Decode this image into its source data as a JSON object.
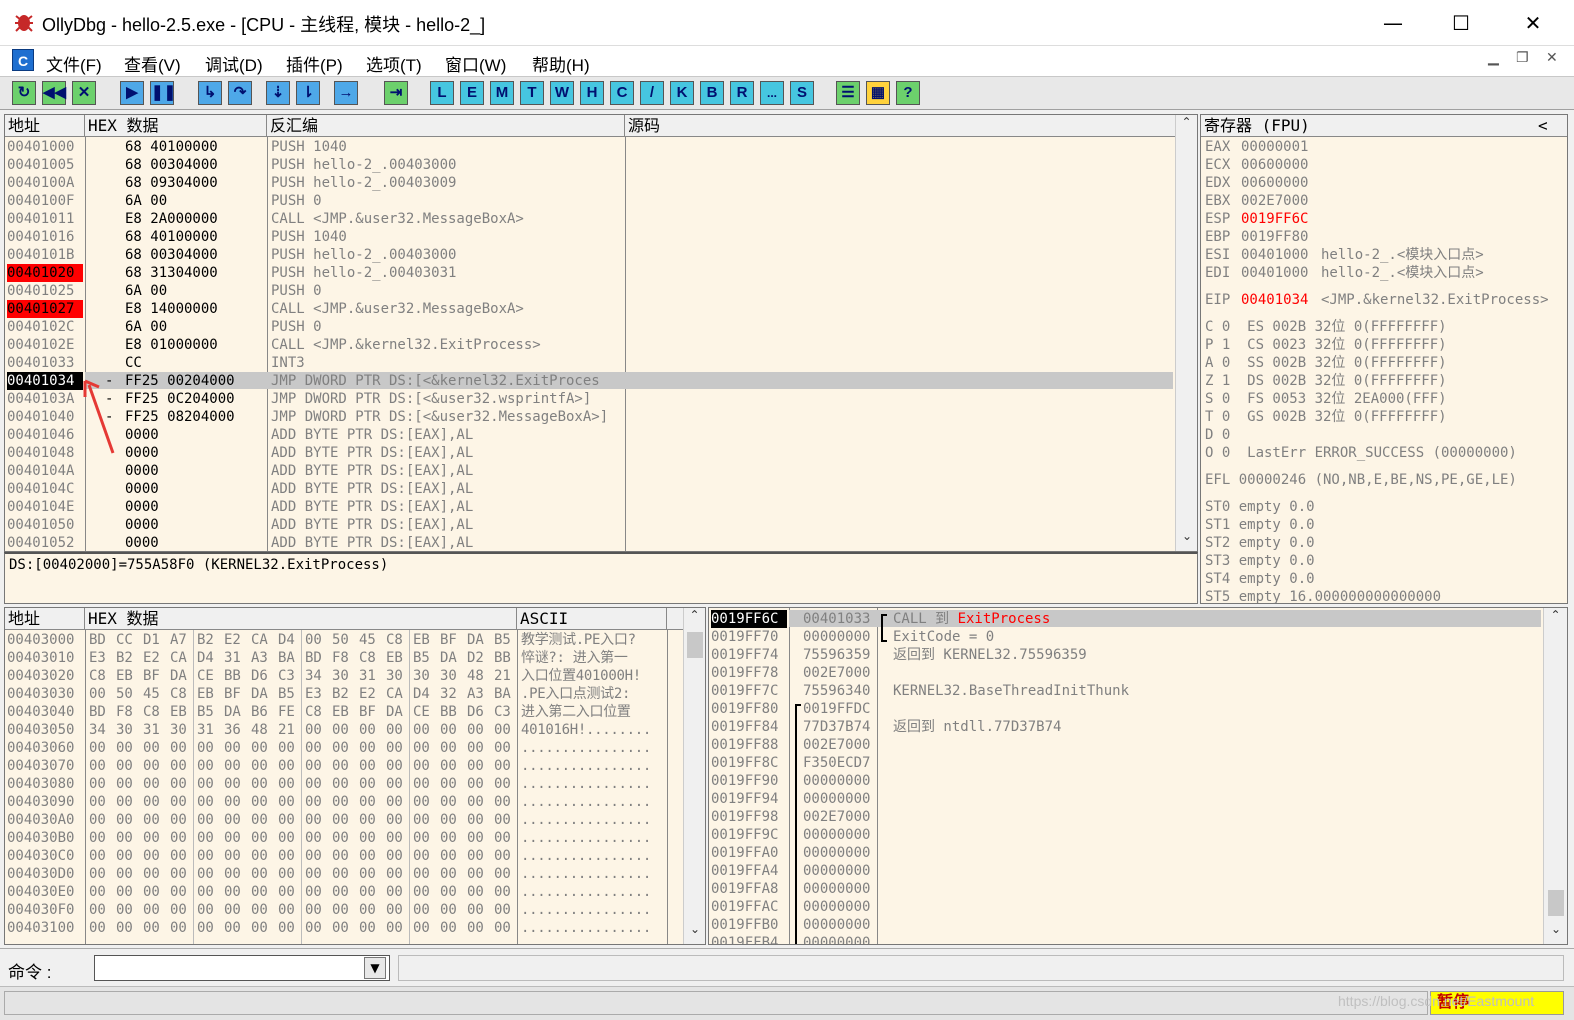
{
  "window": {
    "title": "OllyDbg - hello-2.5.exe - [CPU - 主线程, 模块 - hello-2_]",
    "min": "—",
    "max": "☐",
    "close": "✕"
  },
  "menu": [
    "文件(F)",
    "查看(V)",
    "调试(D)",
    "插件(P)",
    "选项(T)",
    "窗口(W)",
    "帮助(H)"
  ],
  "toolbar": {
    "letters": [
      "L",
      "E",
      "M",
      "T",
      "W",
      "H",
      "C",
      "/",
      "K",
      "B",
      "R",
      "...",
      "S"
    ]
  },
  "disasm": {
    "headers": [
      "地址",
      "HEX 数据",
      "反汇编",
      "源码"
    ],
    "rows": [
      {
        "a": "00401000",
        "m": "",
        "h": "68 40100000",
        "d": "PUSH 1040"
      },
      {
        "a": "00401005",
        "m": "",
        "h": "68 00304000",
        "d": "PUSH hello-2_.00403000"
      },
      {
        "a": "0040100A",
        "m": "",
        "h": "68 09304000",
        "d": "PUSH hello-2_.00403009"
      },
      {
        "a": "0040100F",
        "m": "",
        "h": "6A 00",
        "d": "PUSH 0"
      },
      {
        "a": "00401011",
        "m": "",
        "h": "E8 2A000000",
        "d": "CALL <JMP.&user32.MessageBoxA>"
      },
      {
        "a": "00401016",
        "m": "",
        "h": "68 40100000",
        "d": "PUSH 1040"
      },
      {
        "a": "0040101B",
        "m": "",
        "h": "68 00304000",
        "d": "PUSH hello-2_.00403000"
      },
      {
        "a": "00401020",
        "m": "",
        "h": "68 31304000",
        "d": "PUSH hello-2_.00403031"
      },
      {
        "a": "00401025",
        "m": "",
        "h": "6A 00",
        "d": "PUSH 0"
      },
      {
        "a": "00401027",
        "m": "",
        "h": "E8 14000000",
        "d": "CALL <JMP.&user32.MessageBoxA>"
      },
      {
        "a": "0040102C",
        "m": "",
        "h": "6A 00",
        "d": "PUSH 0"
      },
      {
        "a": "0040102E",
        "m": "",
        "h": "E8 01000000",
        "d": "CALL <JMP.&kernel32.ExitProcess>"
      },
      {
        "a": "00401033",
        "m": "",
        "h": "CC",
        "d": "INT3"
      },
      {
        "a": "00401034",
        "m": "-",
        "h": "FF25 00204000",
        "d": "JMP DWORD PTR DS:[<&kernel32.ExitProces"
      },
      {
        "a": "0040103A",
        "m": "-",
        "h": "FF25 0C204000",
        "d": "JMP DWORD PTR DS:[<&user32.wsprintfA>]"
      },
      {
        "a": "00401040",
        "m": "-",
        "h": "FF25 08204000",
        "d": "JMP DWORD PTR DS:[<&user32.MessageBoxA>]"
      },
      {
        "a": "00401046",
        "m": "",
        "h": "0000",
        "d": "ADD BYTE PTR DS:[EAX],AL"
      },
      {
        "a": "00401048",
        "m": "",
        "h": "0000",
        "d": "ADD BYTE PTR DS:[EAX],AL"
      },
      {
        "a": "0040104A",
        "m": "",
        "h": "0000",
        "d": "ADD BYTE PTR DS:[EAX],AL"
      },
      {
        "a": "0040104C",
        "m": "",
        "h": "0000",
        "d": "ADD BYTE PTR DS:[EAX],AL"
      },
      {
        "a": "0040104E",
        "m": "",
        "h": "0000",
        "d": "ADD BYTE PTR DS:[EAX],AL"
      },
      {
        "a": "00401050",
        "m": "",
        "h": "0000",
        "d": "ADD BYTE PTR DS:[EAX],AL"
      },
      {
        "a": "00401052",
        "m": "",
        "h": "0000",
        "d": "ADD BYTE PTR DS:[EAX],AL"
      }
    ],
    "info": "DS:[00402000]=755A58F0 (KERNEL32.ExitProcess)"
  },
  "registers": {
    "header": "寄存器 (FPU)",
    "collapse": "<",
    "gp": [
      {
        "n": "EAX",
        "v": "00000001",
        "c": "",
        "r": false
      },
      {
        "n": "ECX",
        "v": "00600000",
        "c": "",
        "r": false
      },
      {
        "n": "EDX",
        "v": "00600000",
        "c": "",
        "r": false
      },
      {
        "n": "EBX",
        "v": "002E7000",
        "c": "",
        "r": false
      },
      {
        "n": "ESP",
        "v": "0019FF6C",
        "c": "",
        "r": true
      },
      {
        "n": "EBP",
        "v": "0019FF80",
        "c": "",
        "r": false
      },
      {
        "n": "ESI",
        "v": "00401000",
        "c": "hello-2_.<模块入口点>",
        "r": false
      },
      {
        "n": "EDI",
        "v": "00401000",
        "c": "hello-2_.<模块入口点>",
        "r": false
      }
    ],
    "eip": {
      "n": "EIP",
      "v": "00401034",
      "c": "<JMP.&kernel32.ExitProcess>"
    },
    "flags": [
      "C 0  ES 002B 32位 0(FFFFFFFF)",
      "P 1  CS 0023 32位 0(FFFFFFFF)",
      "A 0  SS 002B 32位 0(FFFFFFFF)",
      "Z 1  DS 002B 32位 0(FFFFFFFF)",
      "S 0  FS 0053 32位 2EA000(FFF)",
      "T 0  GS 002B 32位 0(FFFFFFFF)",
      "D 0",
      "O 0  LastErr ERROR_SUCCESS (00000000)"
    ],
    "efl": "EFL 00000246 (NO,NB,E,BE,NS,PE,GE,LE)",
    "fpu": [
      "ST0 empty 0.0",
      "ST1 empty 0.0",
      "ST2 empty 0.0",
      "ST3 empty 0.0",
      "ST4 empty 0.0",
      "ST5 empty 16.000000000000000"
    ]
  },
  "dump": {
    "headers": [
      "地址",
      "HEX 数据",
      "ASCII"
    ],
    "rows": [
      {
        "a": "00403000",
        "h": [
          "BD",
          "CC",
          "D1",
          "A7",
          "B2",
          "E2",
          "CA",
          "D4",
          "00",
          "50",
          "45",
          "C8",
          "EB",
          "BF",
          "DA",
          "B5"
        ],
        "s": "教学测试.PE入口?"
      },
      {
        "a": "00403010",
        "h": [
          "E3",
          "B2",
          "E2",
          "CA",
          "D4",
          "31",
          "A3",
          "BA",
          "BD",
          "F8",
          "C8",
          "EB",
          "B5",
          "DA",
          "D2",
          "BB"
        ],
        "s": "悴谜?: 进入第一"
      },
      {
        "a": "00403020",
        "h": [
          "C8",
          "EB",
          "BF",
          "DA",
          "CE",
          "BB",
          "D6",
          "C3",
          "34",
          "30",
          "31",
          "30",
          "30",
          "30",
          "48",
          "21"
        ],
        "s": "入口位置401000H!"
      },
      {
        "a": "00403030",
        "h": [
          "00",
          "50",
          "45",
          "C8",
          "EB",
          "BF",
          "DA",
          "B5",
          "E3",
          "B2",
          "E2",
          "CA",
          "D4",
          "32",
          "A3",
          "BA"
        ],
        "s": ".PE入口点测试2:"
      },
      {
        "a": "00403040",
        "h": [
          "BD",
          "F8",
          "C8",
          "EB",
          "B5",
          "DA",
          "B6",
          "FE",
          "C8",
          "EB",
          "BF",
          "DA",
          "CE",
          "BB",
          "D6",
          "C3"
        ],
        "s": "进入第二入口位置"
      },
      {
        "a": "00403050",
        "h": [
          "34",
          "30",
          "31",
          "30",
          "31",
          "36",
          "48",
          "21",
          "00",
          "00",
          "00",
          "00",
          "00",
          "00",
          "00",
          "00"
        ],
        "s": "401016H!........"
      },
      {
        "a": "00403060",
        "h": [
          "00",
          "00",
          "00",
          "00",
          "00",
          "00",
          "00",
          "00",
          "00",
          "00",
          "00",
          "00",
          "00",
          "00",
          "00",
          "00"
        ],
        "s": "................"
      },
      {
        "a": "00403070",
        "h": [
          "00",
          "00",
          "00",
          "00",
          "00",
          "00",
          "00",
          "00",
          "00",
          "00",
          "00",
          "00",
          "00",
          "00",
          "00",
          "00"
        ],
        "s": "................"
      },
      {
        "a": "00403080",
        "h": [
          "00",
          "00",
          "00",
          "00",
          "00",
          "00",
          "00",
          "00",
          "00",
          "00",
          "00",
          "00",
          "00",
          "00",
          "00",
          "00"
        ],
        "s": "................"
      },
      {
        "a": "00403090",
        "h": [
          "00",
          "00",
          "00",
          "00",
          "00",
          "00",
          "00",
          "00",
          "00",
          "00",
          "00",
          "00",
          "00",
          "00",
          "00",
          "00"
        ],
        "s": "................"
      },
      {
        "a": "004030A0",
        "h": [
          "00",
          "00",
          "00",
          "00",
          "00",
          "00",
          "00",
          "00",
          "00",
          "00",
          "00",
          "00",
          "00",
          "00",
          "00",
          "00"
        ],
        "s": "................"
      },
      {
        "a": "004030B0",
        "h": [
          "00",
          "00",
          "00",
          "00",
          "00",
          "00",
          "00",
          "00",
          "00",
          "00",
          "00",
          "00",
          "00",
          "00",
          "00",
          "00"
        ],
        "s": "................"
      },
      {
        "a": "004030C0",
        "h": [
          "00",
          "00",
          "00",
          "00",
          "00",
          "00",
          "00",
          "00",
          "00",
          "00",
          "00",
          "00",
          "00",
          "00",
          "00",
          "00"
        ],
        "s": "................"
      },
      {
        "a": "004030D0",
        "h": [
          "00",
          "00",
          "00",
          "00",
          "00",
          "00",
          "00",
          "00",
          "00",
          "00",
          "00",
          "00",
          "00",
          "00",
          "00",
          "00"
        ],
        "s": "................"
      },
      {
        "a": "004030E0",
        "h": [
          "00",
          "00",
          "00",
          "00",
          "00",
          "00",
          "00",
          "00",
          "00",
          "00",
          "00",
          "00",
          "00",
          "00",
          "00",
          "00"
        ],
        "s": "................"
      },
      {
        "a": "004030F0",
        "h": [
          "00",
          "00",
          "00",
          "00",
          "00",
          "00",
          "00",
          "00",
          "00",
          "00",
          "00",
          "00",
          "00",
          "00",
          "00",
          "00"
        ],
        "s": "................"
      },
      {
        "a": "00403100",
        "h": [
          "00",
          "00",
          "00",
          "00",
          "00",
          "00",
          "00",
          "00",
          "00",
          "00",
          "00",
          "00",
          "00",
          "00",
          "00",
          "00"
        ],
        "s": "................"
      }
    ]
  },
  "stack": {
    "rows": [
      {
        "a": "0019FF6C",
        "v": "00401033",
        "c": "CALL 到 ExitProcess"
      },
      {
        "a": "0019FF70",
        "v": "00000000",
        "c": "ExitCode = 0"
      },
      {
        "a": "0019FF74",
        "v": "75596359",
        "c": "返回到 KERNEL32.75596359"
      },
      {
        "a": "0019FF78",
        "v": "002E7000",
        "c": ""
      },
      {
        "a": "0019FF7C",
        "v": "75596340",
        "c": "KERNEL32.BaseThreadInitThunk"
      },
      {
        "a": "0019FF80",
        "v": "0019FFDC",
        "c": ""
      },
      {
        "a": "0019FF84",
        "v": "77D37B74",
        "c": "返回到 ntdll.77D37B74"
      },
      {
        "a": "0019FF88",
        "v": "002E7000",
        "c": ""
      },
      {
        "a": "0019FF8C",
        "v": "F350ECD7",
        "c": ""
      },
      {
        "a": "0019FF90",
        "v": "00000000",
        "c": ""
      },
      {
        "a": "0019FF94",
        "v": "00000000",
        "c": ""
      },
      {
        "a": "0019FF98",
        "v": "002E7000",
        "c": ""
      },
      {
        "a": "0019FF9C",
        "v": "00000000",
        "c": ""
      },
      {
        "a": "0019FFA0",
        "v": "00000000",
        "c": ""
      },
      {
        "a": "0019FFA4",
        "v": "00000000",
        "c": ""
      },
      {
        "a": "0019FFA8",
        "v": "00000000",
        "c": ""
      },
      {
        "a": "0019FFAC",
        "v": "00000000",
        "c": ""
      },
      {
        "a": "0019FFB0",
        "v": "00000000",
        "c": ""
      },
      {
        "a": "0019FFB4",
        "v": "00000000",
        "c": ""
      }
    ]
  },
  "command": {
    "label": "命令 :",
    "value": ""
  },
  "status": {
    "state": "暂停",
    "watermark": "https://blog.csdn.net/Eastmount"
  }
}
